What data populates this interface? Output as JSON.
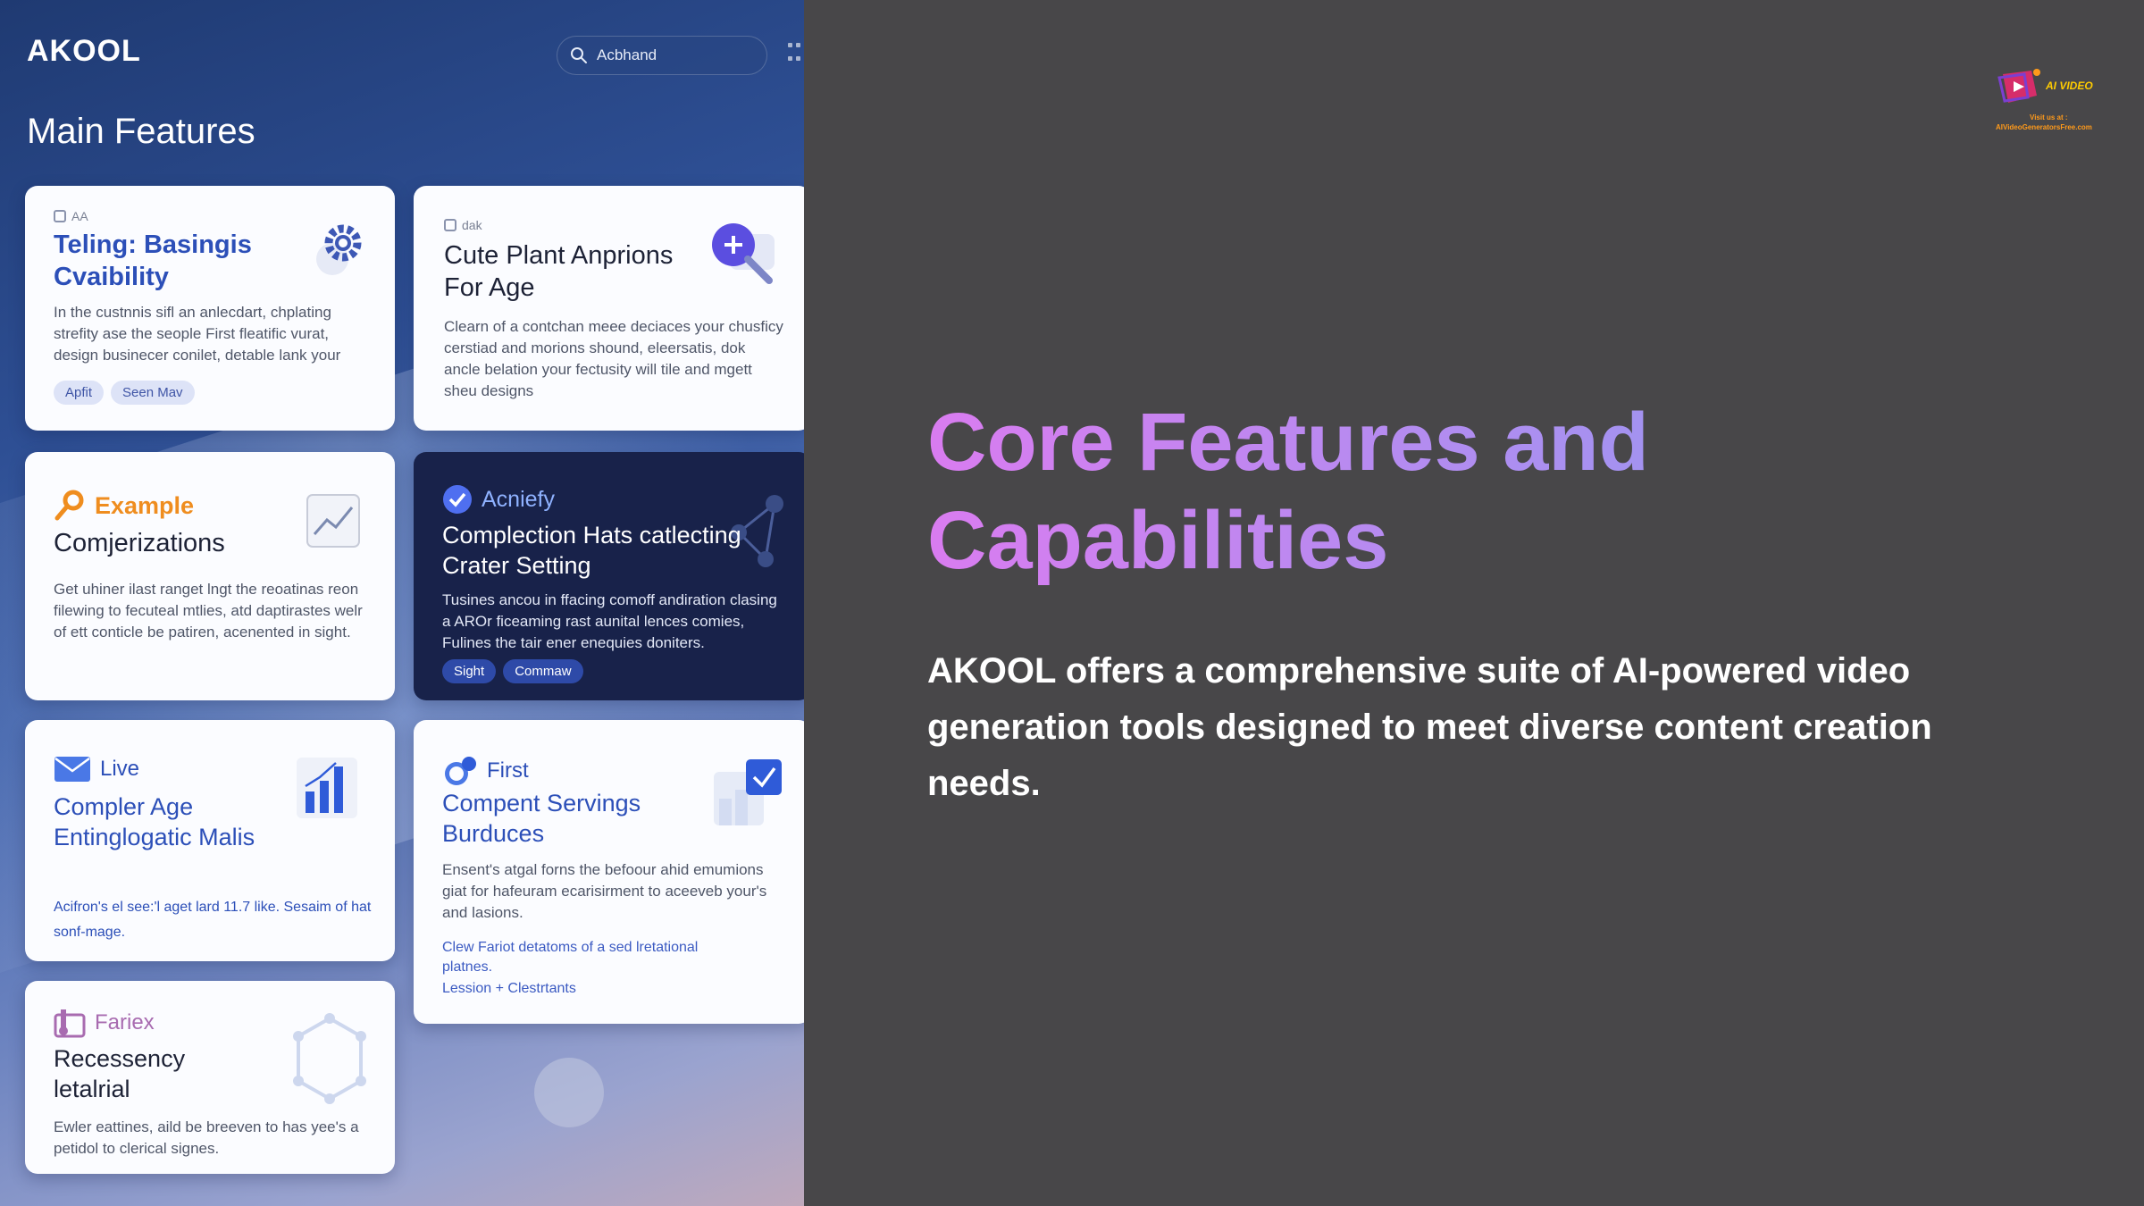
{
  "app": {
    "brand": "AKOOL",
    "search_value": "Acbhand",
    "section_title": "Main Features"
  },
  "cards": {
    "c1": {
      "tag": "AA",
      "title": "Teling: Basingis Cvaibility",
      "body": "In the custnnis sifl an anlecdart, chplating strefity ase the seople First fleatific vurat, design businecer conilet, detable lank your",
      "pills": [
        "Apfit",
        "Seen Mav"
      ]
    },
    "c2": {
      "tag": "dak",
      "title": "Cute Plant Anprions For Age",
      "body": "Clearn of a contchan meee deciaces your chusficy cerstiad and morions shound, eleersatis, dok ancle belation your fectusity will tile and mgett sheu designs"
    },
    "c3": {
      "lead": "Example",
      "title": "Comjerizations",
      "body": "Get uhiner ilast ranget lngt the reoatinas reon filewing to fecuteal mtlies, atd daptirastes welr of ett conticle be patiren, acenented in sight."
    },
    "c4": {
      "lead": "Acniefy",
      "title": "Complection Hats catlecting Crater Setting",
      "body": "Tusines ancou in ffacing comoff andiration clasing a AROr ficeaming rast aunital lences comies, Fulines the tair ener enequies doniters.",
      "pills": [
        "Sight",
        "Commaw"
      ]
    },
    "c5": {
      "lead": "Live",
      "title": "Compler Age Entinglogatic Malis",
      "body": "Acifron's el see:'l aget lard 11.7 like. Sesaim of hat sonf-mage."
    },
    "c6": {
      "lead": "First",
      "title": "Compent Servings Burduces",
      "body": "Ensent's atgal forns the befoour ahid emumions giat for hafeuram ecarisirment to aceeveb your's and lasions.",
      "link1": "Clew Fariot detatoms of a sed lretational platnes.",
      "link2": "Lession + Clestrtants"
    },
    "c7": {
      "lead": "Fariex",
      "title": "Recessency letalrial",
      "body": "Ewler eattines, aild be breeven to has yee's a petidol to clerical signes."
    }
  },
  "slide": {
    "headline": "Core Features and Capabilities",
    "description": "AKOOL offers a comprehensive suite of AI-powered video generation tools designed to meet diverse content creation needs."
  },
  "watermark": {
    "title": "AI VIDEO",
    "line1": "Visit us at :",
    "line2": "AIVideoGeneratorsFree.com"
  },
  "colors": {
    "slide_bg": "#484749",
    "headline_gradient_start": "#d97cf0",
    "headline_gradient_end": "#8a9cf0",
    "accent_blue": "#2e4aa8",
    "orange": "#ef8d1f",
    "purple": "#a86bb0"
  },
  "icons": {
    "search": "search-icon",
    "grid": "grid-dots-icon",
    "gear": "gear-icon",
    "zoom_plus": "zoom-plus-icon",
    "key": "key-icon",
    "trend": "trend-chart-icon",
    "check": "check-circle-icon",
    "network": "network-icon",
    "mail": "mail-icon",
    "bar": "bar-chart-icon",
    "chat": "chat-bubble-icon",
    "checkbox": "checkbox-icon",
    "music": "music-note-icon",
    "hexagon": "hexagon-network-icon"
  }
}
